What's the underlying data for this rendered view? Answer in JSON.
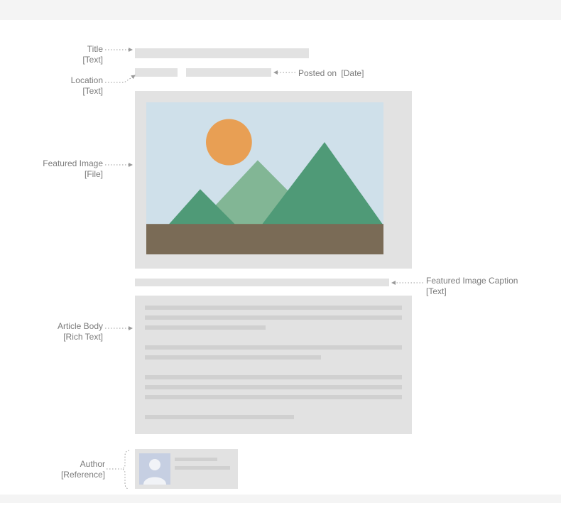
{
  "annotations": {
    "title": {
      "label": "Title",
      "type": "[Text]"
    },
    "posted_on": {
      "label": "Posted on",
      "type": "[Date]"
    },
    "location": {
      "label": "Location",
      "type": "[Text]"
    },
    "featured_image": {
      "label": "Featured Image",
      "type": "[File]"
    },
    "caption": {
      "label": "Featured Image Caption",
      "type": "[Text]"
    },
    "article_body": {
      "label": "Article Body",
      "type": "[Rich Text]"
    },
    "author": {
      "label": "Author",
      "type": "[Reference]"
    }
  }
}
